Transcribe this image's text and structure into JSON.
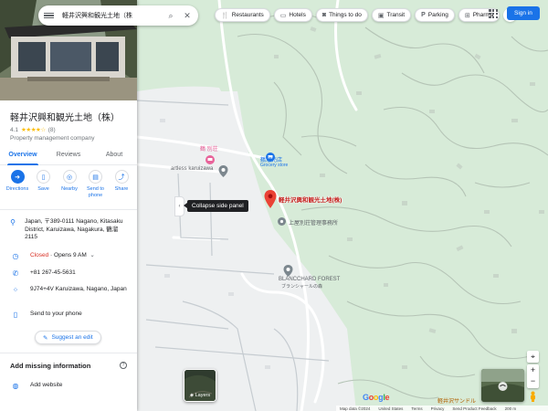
{
  "search": {
    "query": "軽井沢興和観光土地（株",
    "menu_icon": "menu-icon",
    "search_icon": "search-icon",
    "clear_icon": "close-icon"
  },
  "chips": [
    {
      "icon": "fork-knife-icon",
      "label": "Restaurants"
    },
    {
      "icon": "bed-icon",
      "label": "Hotels"
    },
    {
      "icon": "camera-icon",
      "label": "Things to do"
    },
    {
      "icon": "train-icon",
      "label": "Transit"
    },
    {
      "icon": "parking-icon",
      "label": "Parking"
    },
    {
      "icon": "pill-icon",
      "label": "Pharma"
    }
  ],
  "header": {
    "signin_label": "Sign in",
    "apps_icon": "apps-grid-icon"
  },
  "place": {
    "title": "軽井沢興和観光土地（株）",
    "rating": "4.1",
    "stars": "★★★★☆",
    "review_count": "(8)",
    "category": "Property management company"
  },
  "tabs": [
    {
      "label": "Overview",
      "active": true
    },
    {
      "label": "Reviews",
      "active": false
    },
    {
      "label": "About",
      "active": false
    }
  ],
  "actions": [
    {
      "label": "Directions",
      "icon": "directions-icon"
    },
    {
      "label": "Save",
      "icon": "bookmark-icon"
    },
    {
      "label": "Nearby",
      "icon": "nearby-icon"
    },
    {
      "label": "Send to phone",
      "icon": "phone-send-icon"
    },
    {
      "label": "Share",
      "icon": "share-icon"
    }
  ],
  "info": {
    "address": "Japan, 〒389-0111 Nagano, Kitasaku District, Karuizawa, Nagakura, 鶴溜2115",
    "hours_status": "Closed",
    "hours_detail": " · Opens 9 AM",
    "phone": "+81 267-45-5631",
    "plus_code": "9J74+4V Karuizawa, Nagano, Japan",
    "send_label": "Send to your phone"
  },
  "suggest_label": "Suggest an edit",
  "missing": {
    "heading": "Add missing information",
    "website_label": "Add website"
  },
  "collapse_tooltip": "Collapse side panel",
  "map": {
    "pin_label": "軽井沢興和観光土地(株)",
    "labels": {
      "poi1": "鶴 別荘",
      "grocery_jp": "鶴溜売店",
      "grocery_en": "Grocery store",
      "artless": "artless karuizawa",
      "office": "上屋別荘管理事務所",
      "forest_en": "BLANCCHARD FOREST",
      "forest_jp": "ブランシャールの森",
      "bottom_jp": "軽井沢サンドル"
    },
    "layers_label": "Layers",
    "google_logo": "Google"
  },
  "footer": {
    "map_data": "Map data ©2024",
    "country": "United States",
    "terms": "Terms",
    "privacy": "Privacy",
    "feedback": "Send Product Feedback",
    "scale": "200 m"
  },
  "colors": {
    "accent": "#1a73e8",
    "closed": "#d93025",
    "star": "#fbbc04",
    "pin": "#ea4335",
    "map_green": "#d8ecd9"
  }
}
